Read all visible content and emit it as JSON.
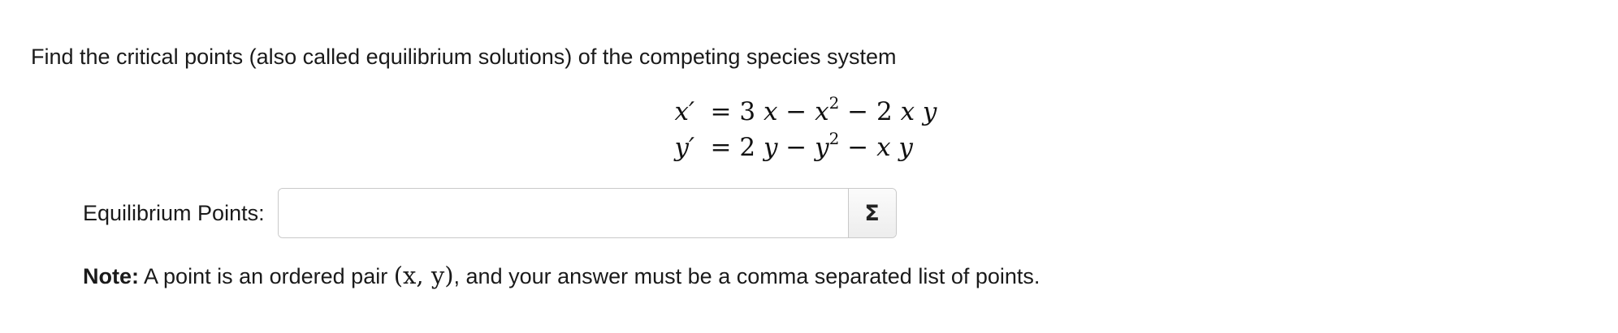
{
  "problem": {
    "prompt": "Find the critical points (also called equilibrium solutions) of the competing species system"
  },
  "system": {
    "eq1_lhs": "x′",
    "eq1_rhs_a": "= 3 ",
    "eq1_rhs_b": "x",
    "eq1_rhs_c": " − ",
    "eq1_rhs_d": "x",
    "eq1_rhs_e": "2",
    "eq1_rhs_f": " − 2 ",
    "eq1_rhs_g": "x y",
    "eq2_lhs": "y′",
    "eq2_rhs_a": "= 2 ",
    "eq2_rhs_b": "y",
    "eq2_rhs_c": " − ",
    "eq2_rhs_d": "y",
    "eq2_rhs_e": "2",
    "eq2_rhs_f": " − ",
    "eq2_rhs_g": "x y"
  },
  "answer": {
    "label": "Equilibrium Points:",
    "value": "",
    "placeholder": "",
    "sigma_label": "Σ"
  },
  "note": {
    "bold": "Note:",
    "text_before": " A point is an ordered pair ",
    "math": "(x, y)",
    "text_after": ", and your answer must be a comma separated list of points."
  },
  "icons": {
    "equation_editor": "sigma-icon"
  }
}
